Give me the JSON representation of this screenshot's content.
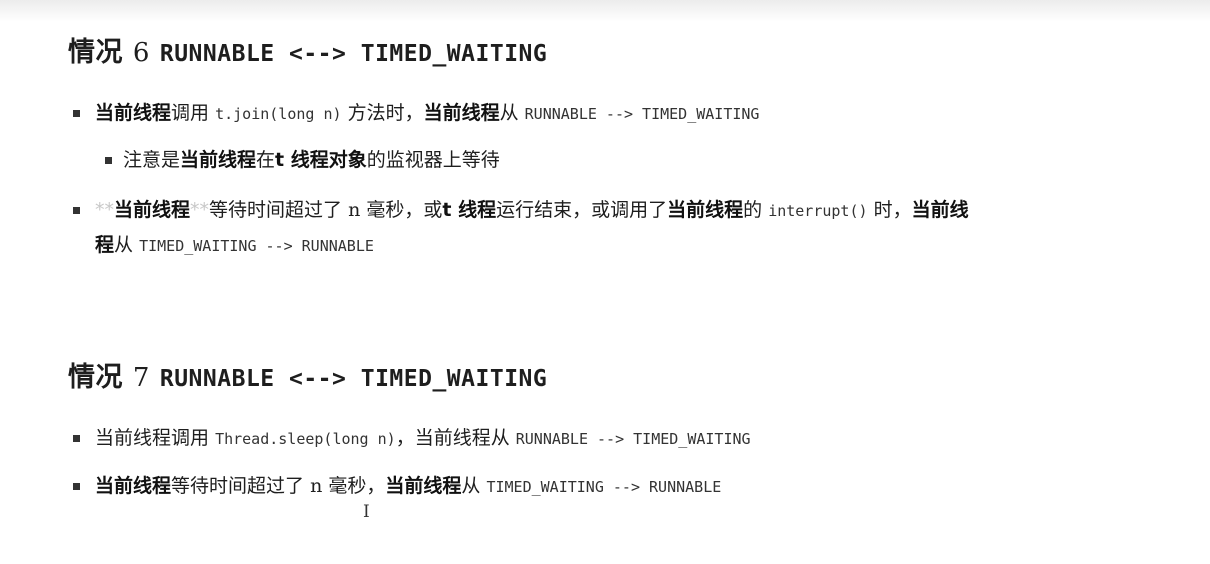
{
  "section6": {
    "heading": {
      "prefix": "情况",
      "num": "6",
      "title": "RUNNABLE <--> TIMED_WAITING"
    },
    "b1": [
      "当前线程",
      "调用",
      "t.join(long n)",
      "方法时，",
      "当前线程",
      "从",
      "RUNNABLE --> TIMED_WAITING"
    ],
    "b1_sub": [
      "注意是",
      "当前线程",
      "在",
      "t 线程对象",
      "的监视器上等待"
    ],
    "b2": [
      "**",
      "当前线程",
      "**",
      "等待时间超过了",
      "n",
      "毫秒，或",
      "t 线程",
      "运行结束，或调用了",
      "当前线程",
      "的",
      "interrupt()",
      "时，",
      "当前线",
      "程",
      "从",
      "TIMED_WAITING --> RUNNABLE"
    ]
  },
  "section7": {
    "heading": {
      "prefix": "情况",
      "num": "7",
      "title": "RUNNABLE <--> TIMED_WAITING"
    },
    "b1": [
      "当前线程调用",
      "Thread.sleep(long n)",
      "，当前线程从",
      "RUNNABLE --> TIMED_WAITING"
    ],
    "b2": [
      "当前线程",
      "等待时间超过了",
      "n",
      "毫秒，",
      "当前线程",
      "从",
      "TIMED_WAITING --> RUNNABLE"
    ]
  },
  "cursor": "I"
}
